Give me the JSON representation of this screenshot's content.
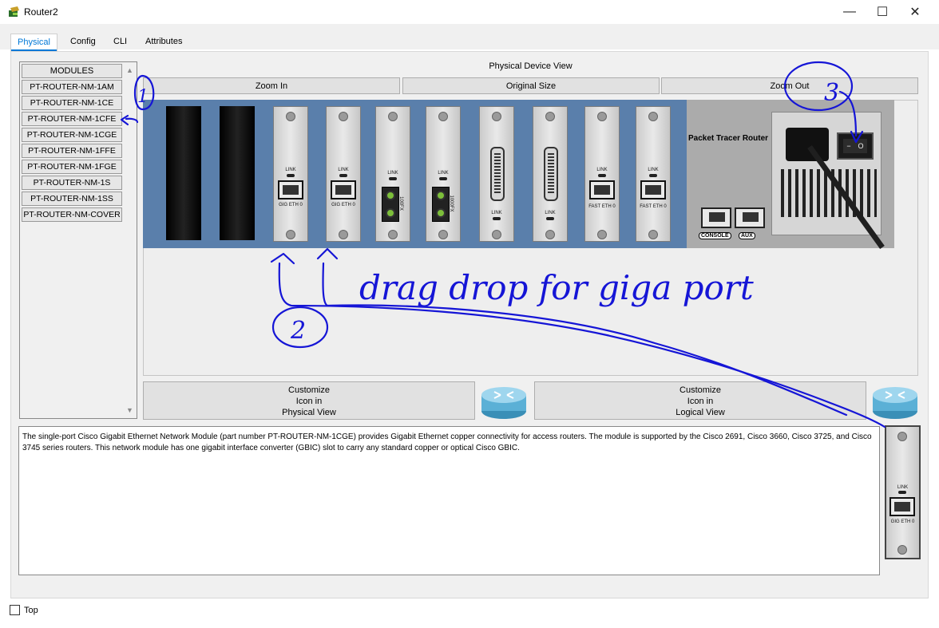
{
  "window": {
    "title": "Router2",
    "minimize": "—",
    "maximize": "☐",
    "close": "✕"
  },
  "tabs": [
    {
      "label": "Physical"
    },
    {
      "label": "Config"
    },
    {
      "label": "CLI"
    },
    {
      "label": "Attributes"
    }
  ],
  "modules": {
    "header": "MODULES",
    "items": [
      "PT-ROUTER-NM-1AM",
      "PT-ROUTER-NM-1CE",
      "PT-ROUTER-NM-1CFE",
      "PT-ROUTER-NM-1CGE",
      "PT-ROUTER-NM-1FFE",
      "PT-ROUTER-NM-1FGE",
      "PT-ROUTER-NM-1S",
      "PT-ROUTER-NM-1SS",
      "PT-ROUTER-NM-COVER"
    ]
  },
  "device_view": {
    "title": "Physical Device View",
    "zoom_in": "Zoom In",
    "original_size": "Original Size",
    "zoom_out": "Zoom Out",
    "router_label": "Packet Tracer Router",
    "console_label": "CONSOLE",
    "aux_label": "AUX",
    "switch_off": "−",
    "switch_on": "O"
  },
  "cards": {
    "link": "LINK",
    "gig_eth": "GIG ETH 0",
    "fast_eth": "FAST ETH 0",
    "fiber_a": "100FX",
    "fiber_b": "1000FX"
  },
  "customize": {
    "physical": {
      "line1": "Customize",
      "line2": "Icon in",
      "line3": "Physical View"
    },
    "logical": {
      "line1": "Customize",
      "line2": "Icon in",
      "line3": "Logical View"
    }
  },
  "description": "The single-port Cisco Gigabit Ethernet Network Module (part number PT-ROUTER-NM-1CGE) provides Gigabit Ethernet copper connectivity for access routers. The module is supported by the Cisco 2691, Cisco 3660, Cisco 3725, and Cisco 3745 series routers. This network module has one gigabit interface converter (GBIC) slot to carry any standard copper or optical Cisco GBIC.",
  "bottom": {
    "top_label": "Top"
  },
  "annotation": {
    "text": "drag drop for giga port",
    "num1": "1",
    "num2": "2",
    "num3": "3",
    "color": "#1515d6"
  }
}
